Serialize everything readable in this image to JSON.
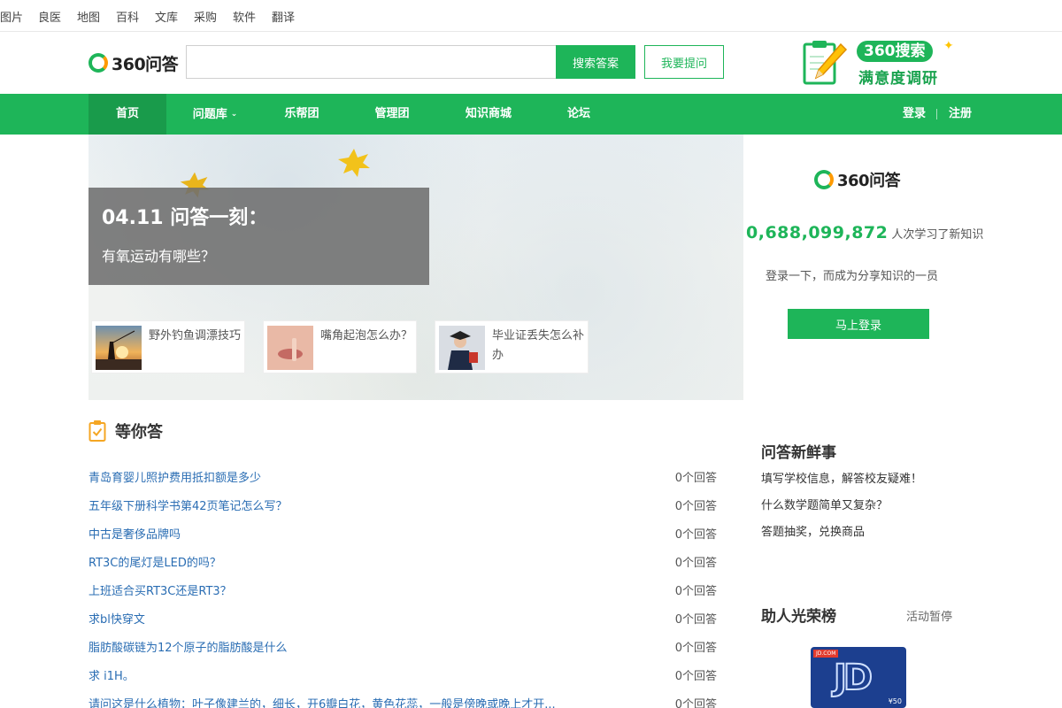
{
  "topbar": {
    "links": [
      "图片",
      "良医",
      "地图",
      "百科",
      "文库",
      "采购",
      "软件",
      "翻译"
    ]
  },
  "header": {
    "logo_text": "360问答",
    "search": {
      "value": "",
      "placeholder": "",
      "button": "搜索答案"
    },
    "ask_button": "我要提问",
    "promo": {
      "badge": "360搜索",
      "subtitle": "满意度调研"
    }
  },
  "nav": {
    "items": [
      "首页",
      "问题库",
      "乐帮团",
      "管理团",
      "知识商城",
      "论坛"
    ],
    "active": "首页",
    "login": "登录",
    "register": "注册"
  },
  "banner": {
    "date_title": "04.11 问答一刻：",
    "question": "有氧运动有哪些？",
    "cards": [
      {
        "text": "野外钓鱼调漂技巧"
      },
      {
        "text": "嘴角起泡怎么办？"
      },
      {
        "text": "毕业证丢失怎么补办"
      }
    ]
  },
  "waiting": {
    "title": "等你答",
    "questions": [
      {
        "title": "青岛育婴儿照护费用抵扣额是多少",
        "answers": "0个回答"
      },
      {
        "title": "五年级下册科学书第42页笔记怎么写？",
        "answers": "0个回答"
      },
      {
        "title": "中古是奢侈品牌吗",
        "answers": "0个回答"
      },
      {
        "title": "RT3C的尾灯是LED的吗？",
        "answers": "0个回答"
      },
      {
        "title": "上班适合买RT3C还是RT3？",
        "answers": "0个回答"
      },
      {
        "title": "求bl快穿文",
        "answers": "0个回答"
      },
      {
        "title": "脂肪酸碳链为12个原子的脂肪酸是什么",
        "answers": "0个回答"
      },
      {
        "title": "求 i1H。",
        "answers": "0个回答"
      },
      {
        "title": "请问这是什么植物：叶子像建兰的，细长，开6瓣白花，黄色花蕊，一般是傍晚或晚上才开...",
        "answers": "0个回答"
      }
    ]
  },
  "sidebar": {
    "logo_text": "360问答",
    "counter": "0,688,099,872",
    "counter_label": "人次学习了新知识",
    "desc": "登录一下，而成为分享知识的一员",
    "login_button": "马上登录",
    "news_title": "问答新鲜事",
    "news": [
      "填写学校信息，解答校友疑难！",
      "什么数学题简单又复杂？",
      "答题抽奖，兑换商品"
    ],
    "honor_title": "助人光荣榜",
    "honor_status": "活动暂停"
  },
  "colors": {
    "brand_green": "#1eb559",
    "link_blue": "#2a6db3",
    "accent_orange": "#ff9a00"
  }
}
